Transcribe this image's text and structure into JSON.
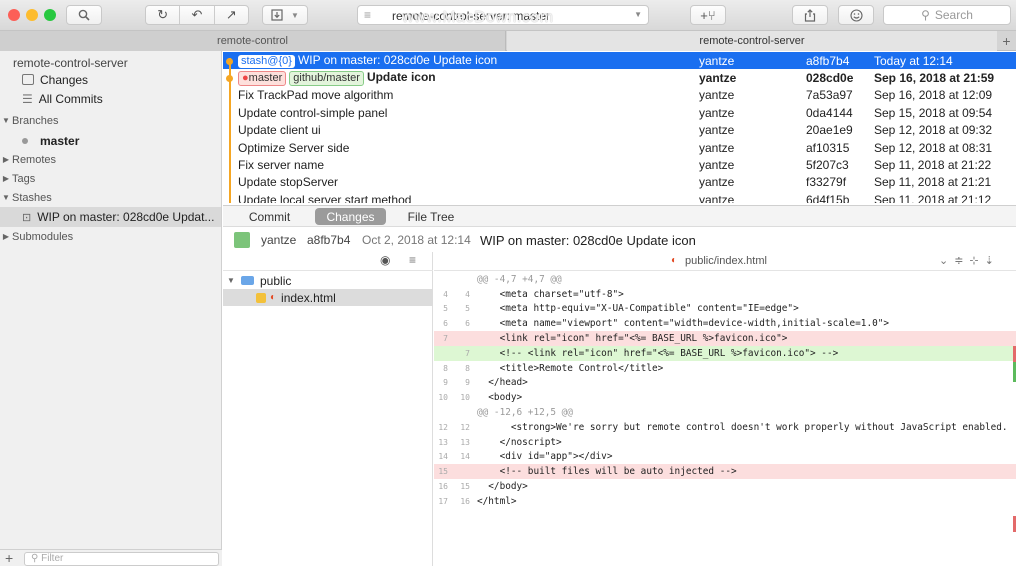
{
  "toolbar": {
    "branch_selector": "remote-control-server: master",
    "search_placeholder": "Search",
    "watermark": "www.MacDown.com"
  },
  "tabs": [
    "remote-control",
    "remote-control-server"
  ],
  "sidebar": {
    "repo": "remote-control-server",
    "changes": "Changes",
    "all_commits": "All Commits",
    "branches_header": "Branches",
    "branch": "master",
    "remotes": "Remotes",
    "tags": "Tags",
    "stashes": "Stashes",
    "stash_item": "WIP on master: 028cd0e Updat...",
    "submodules": "Submodules",
    "filter_placeholder": "Filter"
  },
  "commits": [
    {
      "tag": "stash@{0}",
      "message": "WIP on master: 028cd0e Update icon",
      "author": "yantze",
      "sha": "a8fb7b4",
      "date": "Today at 12:14"
    },
    {
      "tags": [
        "master",
        "github/master"
      ],
      "message": "Update icon",
      "author": "yantze",
      "sha": "028cd0e",
      "date": "Sep 16, 2018 at 21:59"
    },
    {
      "message": "Fix TrackPad move algorithm",
      "author": "yantze",
      "sha": "7a53a97",
      "date": "Sep 16, 2018 at 12:09"
    },
    {
      "message": "Update control-simple panel",
      "author": "yantze",
      "sha": "0da4144",
      "date": "Sep 15, 2018 at 09:54"
    },
    {
      "message": "Update client ui",
      "author": "yantze",
      "sha": "20ae1e9",
      "date": "Sep 12, 2018 at 09:32"
    },
    {
      "message": "Optimize Server side",
      "author": "yantze",
      "sha": "af10315",
      "date": "Sep 12, 2018 at 08:31"
    },
    {
      "message": "Fix server name",
      "author": "yantze",
      "sha": "5f207c3",
      "date": "Sep 11, 2018 at 21:22"
    },
    {
      "message": "Update stopServer",
      "author": "yantze",
      "sha": "f33279f",
      "date": "Sep 11, 2018 at 21:21"
    },
    {
      "message": "Update local server start method",
      "author": "yantze",
      "sha": "6d4f15b",
      "date": "Sep 11, 2018 at 21:12"
    }
  ],
  "detail_tabs": [
    "Commit",
    "Changes",
    "File Tree"
  ],
  "commit_info": {
    "author": "yantze",
    "sha": "a8fb7b4",
    "date": "Oct 2, 2018 at 12:14",
    "message": "WIP on master: 028cd0e Update icon"
  },
  "files": {
    "folder": "public",
    "file": "index.html"
  },
  "diff_title": "public/index.html",
  "diff": [
    {
      "old": "",
      "new": "",
      "code": "@@ -4,7 +4,7 @@",
      "type": "hunk"
    },
    {
      "old": "4",
      "new": "4",
      "code": "    <meta charset=\"utf-8\">",
      "type": ""
    },
    {
      "old": "5",
      "new": "5",
      "code": "    <meta http-equiv=\"X-UA-Compatible\" content=\"IE=edge\">",
      "type": ""
    },
    {
      "old": "6",
      "new": "6",
      "code": "    <meta name=\"viewport\" content=\"width=device-width,initial-scale=1.0\">",
      "type": ""
    },
    {
      "old": "7",
      "new": "",
      "code": "    <link rel=\"icon\" href=\"<%= BASE_URL %>favicon.ico\">",
      "type": "del"
    },
    {
      "old": "",
      "new": "7",
      "code": "    <!-- <link rel=\"icon\" href=\"<%= BASE_URL %>favicon.ico\"> -->",
      "type": "add"
    },
    {
      "old": "8",
      "new": "8",
      "code": "    <title>Remote Control</title>",
      "type": ""
    },
    {
      "old": "9",
      "new": "9",
      "code": "  </head>",
      "type": ""
    },
    {
      "old": "10",
      "new": "10",
      "code": "  <body>",
      "type": ""
    },
    {
      "old": "",
      "new": "",
      "code": "@@ -12,6 +12,5 @@",
      "type": "hunk"
    },
    {
      "old": "12",
      "new": "12",
      "code": "      <strong>We're sorry but remote control doesn't work properly without JavaScript enabled.",
      "type": ""
    },
    {
      "old": "13",
      "new": "13",
      "code": "    </noscript>",
      "type": ""
    },
    {
      "old": "14",
      "new": "14",
      "code": "    <div id=\"app\"></div>",
      "type": ""
    },
    {
      "old": "15",
      "new": "",
      "code": "    <!-- built files will be auto injected -->",
      "type": "del"
    },
    {
      "old": "16",
      "new": "15",
      "code": "  </body>",
      "type": ""
    },
    {
      "old": "17",
      "new": "16",
      "code": "</html>",
      "type": ""
    }
  ]
}
